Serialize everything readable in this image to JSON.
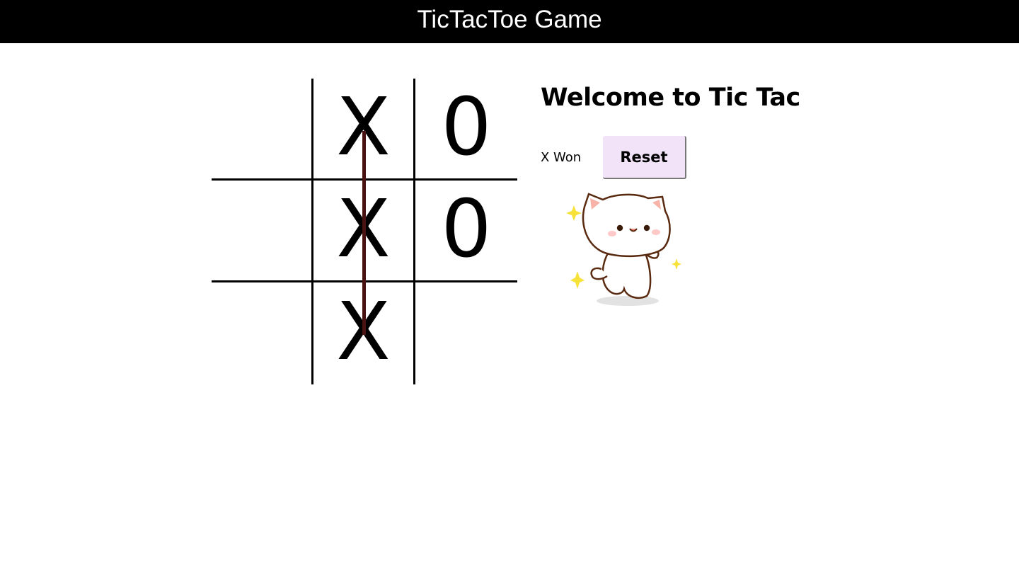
{
  "header": {
    "title": "TicTacToe Game"
  },
  "board": {
    "cells": [
      "",
      "X",
      "0",
      "",
      "X",
      "0",
      "",
      "X",
      ""
    ]
  },
  "info": {
    "welcome": "Welcome to Tic Tac",
    "status": "X Won",
    "reset_label": "Reset"
  },
  "colors": {
    "header_bg": "#000000",
    "win_line": "#4a1111",
    "reset_bg": "#f3e3f8"
  },
  "icons": {
    "celebration": "dancing-cat-icon"
  }
}
